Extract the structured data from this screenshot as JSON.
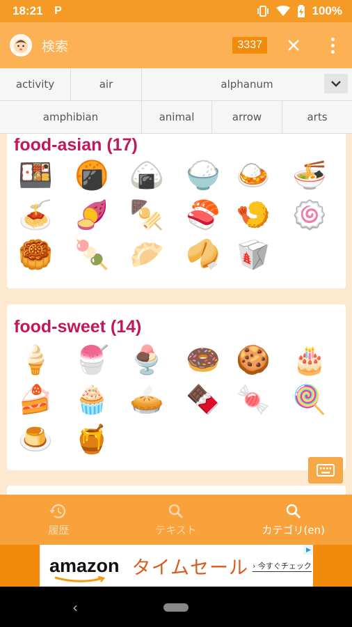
{
  "status_bar": {
    "time": "18:21",
    "app_icon": "P",
    "battery": "100%"
  },
  "appbar": {
    "search_placeholder": "検索",
    "count": "3337"
  },
  "categories": [
    {
      "label": "activity"
    },
    {
      "label": "air"
    },
    {
      "label": "alphanum"
    },
    {
      "label": "amphibian"
    },
    {
      "label": "animal"
    },
    {
      "label": "arrow"
    },
    {
      "label": "arts"
    }
  ],
  "sections": [
    {
      "title": "food-asian (17)",
      "emojis": [
        "🍱",
        "🍘",
        "🍙",
        "🍚",
        "🍛",
        "🍜",
        "🍝",
        "🍠",
        "🍢",
        "🍣",
        "🍤",
        "🍥",
        "🥮",
        "🍡",
        "🥟",
        "🥠",
        "🥡"
      ]
    },
    {
      "title": "food-sweet (14)",
      "emojis": [
        "🍦",
        "🍧",
        "🍨",
        "🍩",
        "🍪",
        "🎂",
        "🍰",
        "🧁",
        "🥧",
        "🍫",
        "🍬",
        "🍭",
        "🍮",
        "🍯"
      ]
    }
  ],
  "bottom_nav": [
    {
      "label": "履歴",
      "icon": "history-icon"
    },
    {
      "label": "テキスト",
      "icon": "search-icon"
    },
    {
      "label": "カテゴリ(en)",
      "icon": "search-icon",
      "active": true
    }
  ],
  "ad": {
    "brand": "amazon",
    "headline": "タイムセール",
    "cta": "› 今すぐチェック"
  },
  "colors": {
    "accent": "#f59a24",
    "title": "#c2185b",
    "nav": "#f9a23c"
  }
}
